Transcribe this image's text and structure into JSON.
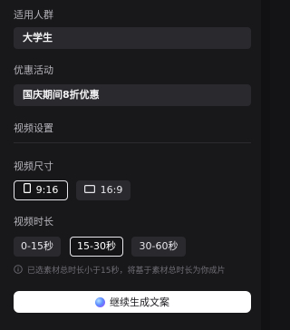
{
  "audience": {
    "label": "适用人群",
    "value": "大学生"
  },
  "promotion": {
    "label": "优惠活动",
    "value": "国庆期间8折优惠"
  },
  "video_settings": {
    "title": "视频设置"
  },
  "video_size": {
    "label": "视频尺寸",
    "options": [
      {
        "label": "9:16",
        "icon": "portrait-icon",
        "selected": true
      },
      {
        "label": "16:9",
        "icon": "landscape-icon",
        "selected": false
      }
    ]
  },
  "video_duration": {
    "label": "视频时长",
    "options": [
      {
        "label": "0-15秒",
        "selected": false
      },
      {
        "label": "15-30秒",
        "selected": true
      },
      {
        "label": "30-60秒",
        "selected": false
      }
    ]
  },
  "hint": {
    "icon": "info-icon",
    "text": "已选素材总时长小于15秒，将基于素材总时长为你成片"
  },
  "generate_button": {
    "label": "继续生成文案",
    "icon": "ai-orb-icon"
  },
  "colors": {
    "background": "#18181b",
    "field": "#2a2a2e",
    "selected_border": "#e8e8ec",
    "button": "#ffffff"
  }
}
